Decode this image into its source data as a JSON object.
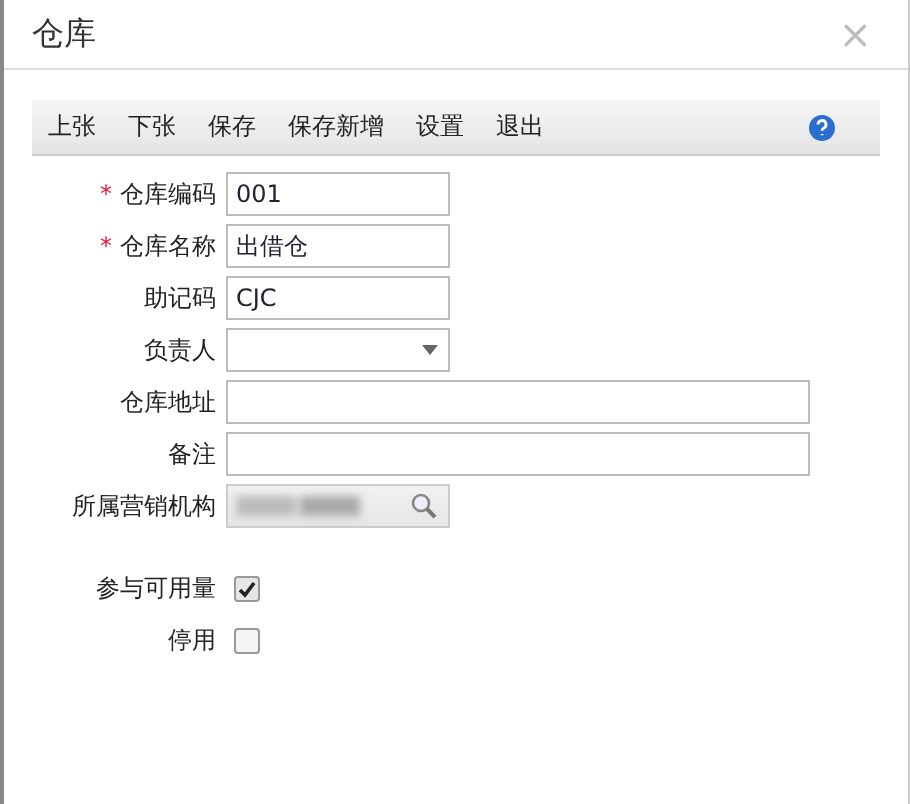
{
  "window": {
    "title": "仓库",
    "close": "×"
  },
  "toolbar": {
    "buttons": [
      "上张",
      "下张",
      "保存",
      "保存新增",
      "设置",
      "退出"
    ]
  },
  "form": [
    {
      "kind": "text",
      "label": "仓库编码",
      "mark": "*",
      "value": "001"
    },
    {
      "kind": "text",
      "label": "仓库名称",
      "mark": "*",
      "value": "出借仓"
    },
    {
      "kind": "text",
      "label": "助记码",
      "value": "CJC"
    },
    {
      "kind": "select",
      "label": "负责人"
    },
    {
      "kind": "longtext",
      "label": "仓库地址"
    },
    {
      "kind": "longtext",
      "label": "备注"
    },
    {
      "kind": "search",
      "label": "所属营销机构"
    },
    {
      "kind": "checkbox",
      "label": "参与可用量",
      "checked": true
    },
    {
      "kind": "checkbox",
      "label": "停用",
      "checked": false
    }
  ]
}
